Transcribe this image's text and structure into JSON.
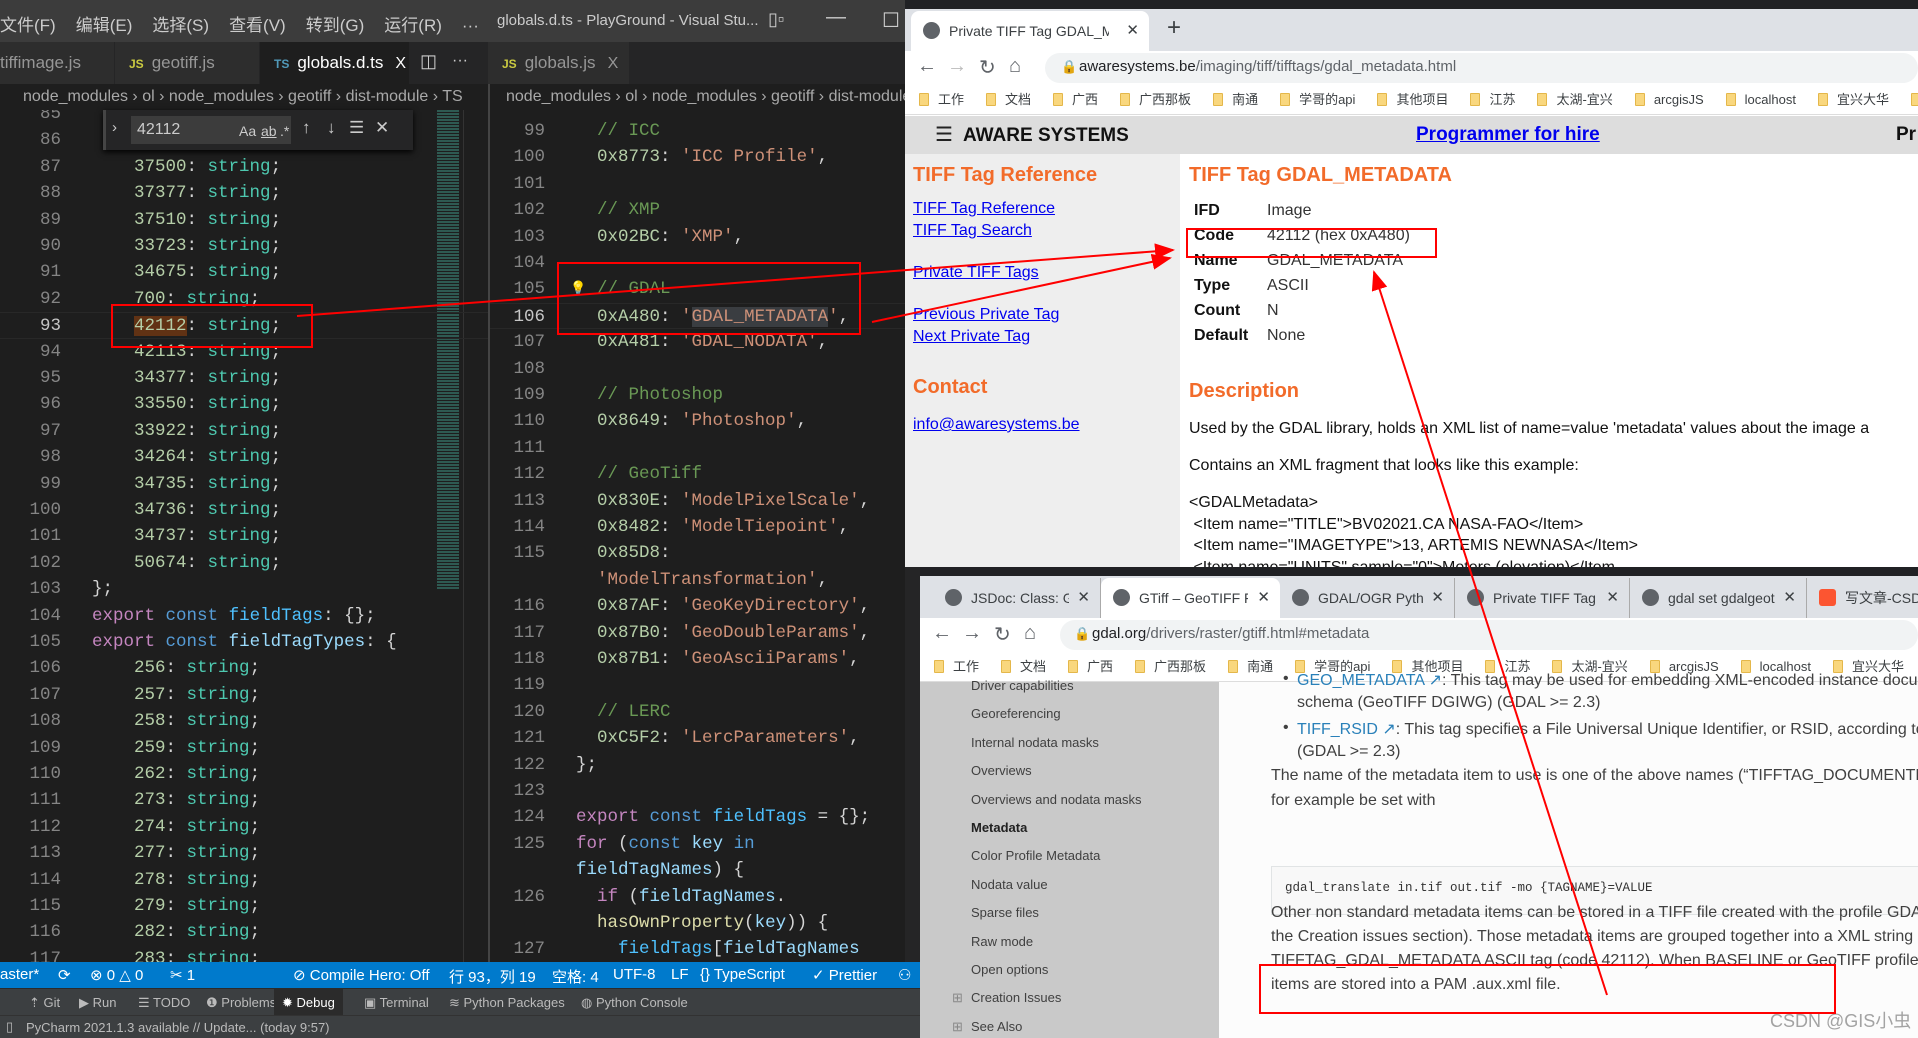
{
  "vscode": {
    "menu": [
      "文件(F)",
      "编辑(E)",
      "选择(S)",
      "查看(V)",
      "转到(G)",
      "运行(R)",
      "···"
    ],
    "window_title": "globals.d.ts - PlayGround - Visual Stu...",
    "tabs_left": [
      {
        "lang": "",
        "label": "tiffimage.js"
      },
      {
        "lang": "JS",
        "label": "geotiff.js"
      },
      {
        "lang": "TS",
        "label": "globals.d.ts",
        "close": "X"
      }
    ],
    "tabs_right": [
      {
        "lang": "JS",
        "label": "globals.js",
        "close": "X"
      }
    ],
    "more_label": "···",
    "breadcrumb_left": "node_modules › ol › node_modules › geotiff › dist-module › TS",
    "breadcrumb_right": "node_modules › ol › node_modules › geotiff › dist-module",
    "find": {
      "query": "42112",
      "case": "Aa",
      "word": "ab",
      "regex": ".*"
    },
    "left_editor": {
      "current_line": 93,
      "match_text": "42112",
      "lines": [
        {
          "n": 85,
          "text": ""
        },
        {
          "n": 86,
          "text": ""
        },
        {
          "n": 87,
          "text": "    37500: string;"
        },
        {
          "n": 88,
          "text": "    37377: string;"
        },
        {
          "n": 89,
          "text": "    37510: string;"
        },
        {
          "n": 90,
          "text": "    33723: string;"
        },
        {
          "n": 91,
          "text": "    34675: string;"
        },
        {
          "n": 92,
          "text": "    700: string;"
        },
        {
          "n": 93,
          "text": "    42112: string;"
        },
        {
          "n": 94,
          "text": "    42113: string;"
        },
        {
          "n": 95,
          "text": "    34377: string;"
        },
        {
          "n": 96,
          "text": "    33550: string;"
        },
        {
          "n": 97,
          "text": "    33922: string;"
        },
        {
          "n": 98,
          "text": "    34264: string;"
        },
        {
          "n": 99,
          "text": "    34735: string;"
        },
        {
          "n": 100,
          "text": "    34736: string;"
        },
        {
          "n": 101,
          "text": "    34737: string;"
        },
        {
          "n": 102,
          "text": "    50674: string;"
        },
        {
          "n": 103,
          "text": "};"
        },
        {
          "n": 104,
          "text": "export const fieldTags: {};"
        },
        {
          "n": 105,
          "text": "export const fieldTagTypes: {"
        },
        {
          "n": 106,
          "text": "    256: string;"
        },
        {
          "n": 107,
          "text": "    257: string;"
        },
        {
          "n": 108,
          "text": "    258: string;"
        },
        {
          "n": 109,
          "text": "    259: string;"
        },
        {
          "n": 110,
          "text": "    262: string;"
        },
        {
          "n": 111,
          "text": "    273: string;"
        },
        {
          "n": 112,
          "text": "    274: string;"
        },
        {
          "n": 113,
          "text": "    277: string;"
        },
        {
          "n": 114,
          "text": "    278: string;"
        },
        {
          "n": 115,
          "text": "    279: string;"
        },
        {
          "n": 116,
          "text": "    282: string;"
        },
        {
          "n": 117,
          "text": "    283: string;"
        }
      ]
    },
    "right_editor": {
      "current_line": 106,
      "selected_text": "GDAL_METADATA",
      "lines": [
        {
          "n": 99,
          "text": "  // ICC"
        },
        {
          "n": 100,
          "text": "  0x8773: 'ICC Profile',"
        },
        {
          "n": 101,
          "text": ""
        },
        {
          "n": 102,
          "text": "  // XMP"
        },
        {
          "n": 103,
          "text": "  0x02BC: 'XMP',"
        },
        {
          "n": 104,
          "text": ""
        },
        {
          "n": 105,
          "text": "  // GDAL"
        },
        {
          "n": 106,
          "text": "  0xA480: 'GDAL_METADATA',"
        },
        {
          "n": 107,
          "text": "  0xA481: 'GDAL_NODATA',"
        },
        {
          "n": 108,
          "text": ""
        },
        {
          "n": 109,
          "text": "  // Photoshop"
        },
        {
          "n": 110,
          "text": "  0x8649: 'Photoshop',"
        },
        {
          "n": 111,
          "text": ""
        },
        {
          "n": 112,
          "text": "  // GeoTiff"
        },
        {
          "n": 113,
          "text": "  0x830E: 'ModelPixelScale',"
        },
        {
          "n": 114,
          "text": "  0x8482: 'ModelTiepoint',"
        },
        {
          "n": 115,
          "text": "  0x85D8:"
        },
        {
          "n": null,
          "text": "  'ModelTransformation',"
        },
        {
          "n": 116,
          "text": "  0x87AF: 'GeoKeyDirectory',"
        },
        {
          "n": 117,
          "text": "  0x87B0: 'GeoDoubleParams',"
        },
        {
          "n": 118,
          "text": "  0x87B1: 'GeoAsciiParams',"
        },
        {
          "n": 119,
          "text": ""
        },
        {
          "n": 120,
          "text": "  // LERC"
        },
        {
          "n": 121,
          "text": "  0xC5F2: 'LercParameters',"
        },
        {
          "n": 122,
          "text": "};"
        },
        {
          "n": 123,
          "text": ""
        },
        {
          "n": 124,
          "text": "export const fieldTags = {};"
        },
        {
          "n": 125,
          "text": "for (const key in"
        },
        {
          "n": null,
          "text": "fieldTagNames) {"
        },
        {
          "n": 126,
          "text": "  if (fieldTagNames."
        },
        {
          "n": null,
          "text": "  hasOwnProperty(key)) {"
        },
        {
          "n": 127,
          "text": "    fieldTags[fieldTagNames"
        }
      ]
    },
    "status": {
      "branch": "aster*",
      "errors": "0",
      "warnings": "0",
      "tools": "1",
      "compile_hero": "Compile Hero: Off",
      "position": "行 93，列 19",
      "spaces": "空格: 4",
      "encoding": "UTF-8",
      "eol": "LF",
      "language": "TypeScript",
      "prettier": "Prettier"
    }
  },
  "pycharm": {
    "tools": [
      "Git",
      "Run",
      "TODO",
      "Problems",
      "Debug",
      "Terminal",
      "Python Packages",
      "Python Console"
    ],
    "active_tool": "Debug",
    "status": "PyCharm 2021.1.3 available // Update... (today 9:57)"
  },
  "browser1": {
    "tab_title": "Private TIFF Tag GDAL_METADATA",
    "new_tab": "+",
    "url_host": "awaresystems.be",
    "url_path": "/imaging/tiff/tifftags/gdal_metadata.html",
    "bookmarks": [
      "工作",
      "文档",
      "广西",
      "广西那板",
      "南通",
      "学哥的api",
      "其他项目",
      "江苏",
      "太湖-宜兴",
      "arcgisJS",
      "localhost",
      "宜兴大华",
      "工业"
    ],
    "site_name": "AWARE SYSTEMS",
    "header_link": "Programmer for hire",
    "header_right": "Pr",
    "nav_heading": "TIFF Tag Reference",
    "nav_links": [
      "TIFF Tag Reference",
      "TIFF Tag Search",
      "Private TIFF Tags",
      "Previous Private Tag",
      "Next Private Tag"
    ],
    "contact_heading": "Contact",
    "contact_email": "info@awaresystems.be",
    "title": "TIFF Tag GDAL_METADATA",
    "props": [
      {
        "k": "IFD",
        "v": "Image"
      },
      {
        "k": "Code",
        "v": "42112 (hex 0xA480)"
      },
      {
        "k": "Name",
        "v": "GDAL_METADATA"
      },
      {
        "k": "Type",
        "v": "ASCII"
      },
      {
        "k": "Count",
        "v": "N"
      },
      {
        "k": "Default",
        "v": "None"
      }
    ],
    "description_heading": "Description",
    "description": [
      "Used by the GDAL library, holds an XML list of name=value 'metadata' values about the image a",
      "Contains an XML fragment that looks like this example:"
    ],
    "xml": [
      "<GDALMetadata>",
      " <Item name=\"TITLE\">BV02021.CA NASA-FAO</Item>",
      " <Item name=\"IMAGETYPE\">13, ARTEMIS NEWNASA</Item>",
      " <Item name=\"UNITS\" sample=\"0\">Meters (elevation)</Item"
    ]
  },
  "browser2": {
    "tabs": [
      {
        "title": "JSDoc: Class: GeoTI"
      },
      {
        "title": "GTiff – GeoTIFF File",
        "active": true
      },
      {
        "title": "GDAL/OGR Python"
      },
      {
        "title": "Private TIFF Tag GD"
      },
      {
        "title": "gdal set gdalgeotiff"
      },
      {
        "title": "写文章-CSDN"
      }
    ],
    "url_host": "gdal.org",
    "url_path": "/drivers/raster/gtiff.html#metadata",
    "sidebar": [
      "Driver capabilities",
      "Georeferencing",
      "Internal nodata masks",
      "Overviews",
      "Overviews and nodata masks",
      "Metadata",
      "Color Profile Metadata",
      "Nodata value",
      "Sparse files",
      "Raw mode",
      "Open options",
      "Creation Issues",
      "See Also"
    ],
    "sidebar_active": "Metadata",
    "bullets": [
      {
        "link": "GEO_METADATA",
        "text": ": This tag may be used for embedding XML-encoded instance docum",
        "cont": "schema (GeoTIFF DGIWG) (GDAL >= 2.3)"
      },
      {
        "link": "TIFF_RSID",
        "text": ": This tag specifies a File Universal Unique Identifier, or RSID, according to D",
        "cont": "(GDAL >= 2.3)"
      }
    ],
    "para1": [
      "The name of the metadata item to use is one of the above names (“TIFFTAG_DOCUMENTNA",
      "for example be set with"
    ],
    "code_sample": "gdal_translate in.tif out.tif -mo {TAGNAME}=VALUE",
    "para2": [
      "Other non standard metadata items can be stored in a TIFF file created with the profile GDAL",
      "the Creation issues section). Those metadata items are grouped together into a XML string st",
      "TIFFTAG_GDAL_METADATA ASCII tag (code 42112). When BASELINE or GeoTIFF profile are",
      "items are stored into a PAM .aux.xml file."
    ]
  },
  "watermark": "CSDN @GIS小虫",
  "colors": {
    "annotation": "#ff0000",
    "status_bar": "#007acc",
    "aware_heading": "#f26b2a",
    "link": "#0000ee"
  }
}
